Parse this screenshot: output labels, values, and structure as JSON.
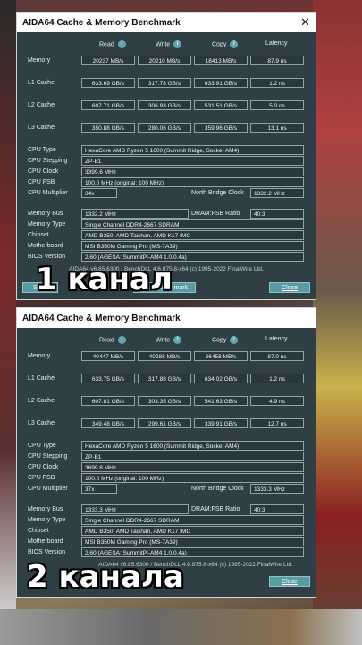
{
  "overlays": {
    "first": "1 канал",
    "second": "2 канала"
  },
  "windows": [
    {
      "title": "AIDA64 Cache & Memory Benchmark",
      "headers": {
        "read": "Read",
        "write": "Write",
        "copy": "Copy",
        "latency": "Latency"
      },
      "rows": [
        {
          "label": "Memory",
          "read": "20237 MB/s",
          "write": "20210 MB/s",
          "copy": "18413 MB/s",
          "latency": "87.9 ns"
        },
        {
          "label": "L1 Cache",
          "read": "633.69 GB/s",
          "write": "317.78 GB/s",
          "copy": "633.91 GB/s",
          "latency": "1.2 ns"
        },
        {
          "label": "L2 Cache",
          "read": "607.71 GB/s",
          "write": "306.93 GB/s",
          "copy": "531.51 GB/s",
          "latency": "5.0 ns"
        },
        {
          "label": "L3 Cache",
          "read": "350.88 GB/s",
          "write": "280.06 GB/s",
          "copy": "359.96 GB/s",
          "latency": "13.1 ns"
        }
      ],
      "cpu": {
        "type_label": "CPU Type",
        "type": "HexaCore AMD Ryzen 5 1600  (Summit Ridge, Socket AM4)",
        "stepping_label": "CPU Stepping",
        "stepping": "ZP-B1",
        "clock_label": "CPU Clock",
        "clock": "3399.6 MHz",
        "fsb_label": "CPU FSB",
        "fsb": "100.0 MHz  (original: 100 MHz)",
        "mult_label": "CPU Multiplier",
        "mult": "34x",
        "nb_label": "North Bridge Clock",
        "nb": "1332.2 MHz"
      },
      "mem": {
        "bus_label": "Memory Bus",
        "bus": "1332.2 MHz",
        "ratio_label": "DRAM:FSB Ratio",
        "ratio": "40:3",
        "type_label": "Memory Type",
        "type": "Single Channel DDR4-2667 SDRAM",
        "chipset_label": "Chipset",
        "chipset": "AMD B350, AMD Taishan, AMD K17 IMC",
        "mb_label": "Motherboard",
        "mb": "MSI B350M Gaming Pro (MS-7A39)",
        "bios_label": "BIOS Version",
        "bios": "2.60  (AGESA: SummitPI-AM4 1.0.0.4a)"
      },
      "footer": "AIDA64 v6.85.6300 / BenchDLL 4.6.875.8-x64  (c) 1995-2022 FinalWire Ltd.",
      "buttons": {
        "save": "Save",
        "start": "Start Benchmark",
        "close": "Close"
      }
    },
    {
      "title": "AIDA64 Cache & Memory Benchmark",
      "headers": {
        "read": "Read",
        "write": "Write",
        "copy": "Copy",
        "latency": "Latency"
      },
      "rows": [
        {
          "label": "Memory",
          "read": "40447 MB/s",
          "write": "40288 MB/s",
          "copy": "36458 MB/s",
          "latency": "87.0 ns"
        },
        {
          "label": "L1 Cache",
          "read": "633.75 GB/s",
          "write": "317.88 GB/s",
          "copy": "634.02 GB/s",
          "latency": "1.2 ns"
        },
        {
          "label": "L2 Cache",
          "read": "607.81 GB/s",
          "write": "303.35 GB/s",
          "copy": "541.63 GB/s",
          "latency": "4.9 ns"
        },
        {
          "label": "L3 Cache",
          "read": "349.48 GB/s",
          "write": "299.61 GB/s",
          "copy": "339.91 GB/s",
          "latency": "12.7 ns"
        }
      ],
      "cpu": {
        "type_label": "CPU Type",
        "type": "HexaCore AMD Ryzen 5 1600  (Summit Ridge, Socket AM4)",
        "stepping_label": "CPU Stepping",
        "stepping": "ZP-B1",
        "clock_label": "CPU Clock",
        "clock": "3699.8 MHz",
        "fsb_label": "CPU FSB",
        "fsb": "100.0 MHz  (original: 100 MHz)",
        "mult_label": "CPU Multiplier",
        "mult": "37x",
        "nb_label": "North Bridge Clock",
        "nb": "1333.3 MHz"
      },
      "mem": {
        "bus_label": "Memory Bus",
        "bus": "1333.3 MHz",
        "ratio_label": "DRAM:FSB Ratio",
        "ratio": "40:3",
        "type_label": "Memory Type",
        "type": "Single Channel DDR4-2667 SDRAM",
        "chipset_label": "Chipset",
        "chipset": "AMD B350, AMD Taishan, AMD K17 IMC",
        "mb_label": "Motherboard",
        "mb": "MSI B350M Gaming Pro (MS-7A39)",
        "bios_label": "BIOS Version",
        "bios": "2.60  (AGESA: SummitPI-AM4 1.0.0.4a)"
      },
      "footer": "AIDA64 v6.85.6300 / BenchDLL 4.6.875.8-x64  (c) 1995-2022 FinalWire Ltd.",
      "buttons": {
        "close": "Close"
      }
    }
  ]
}
